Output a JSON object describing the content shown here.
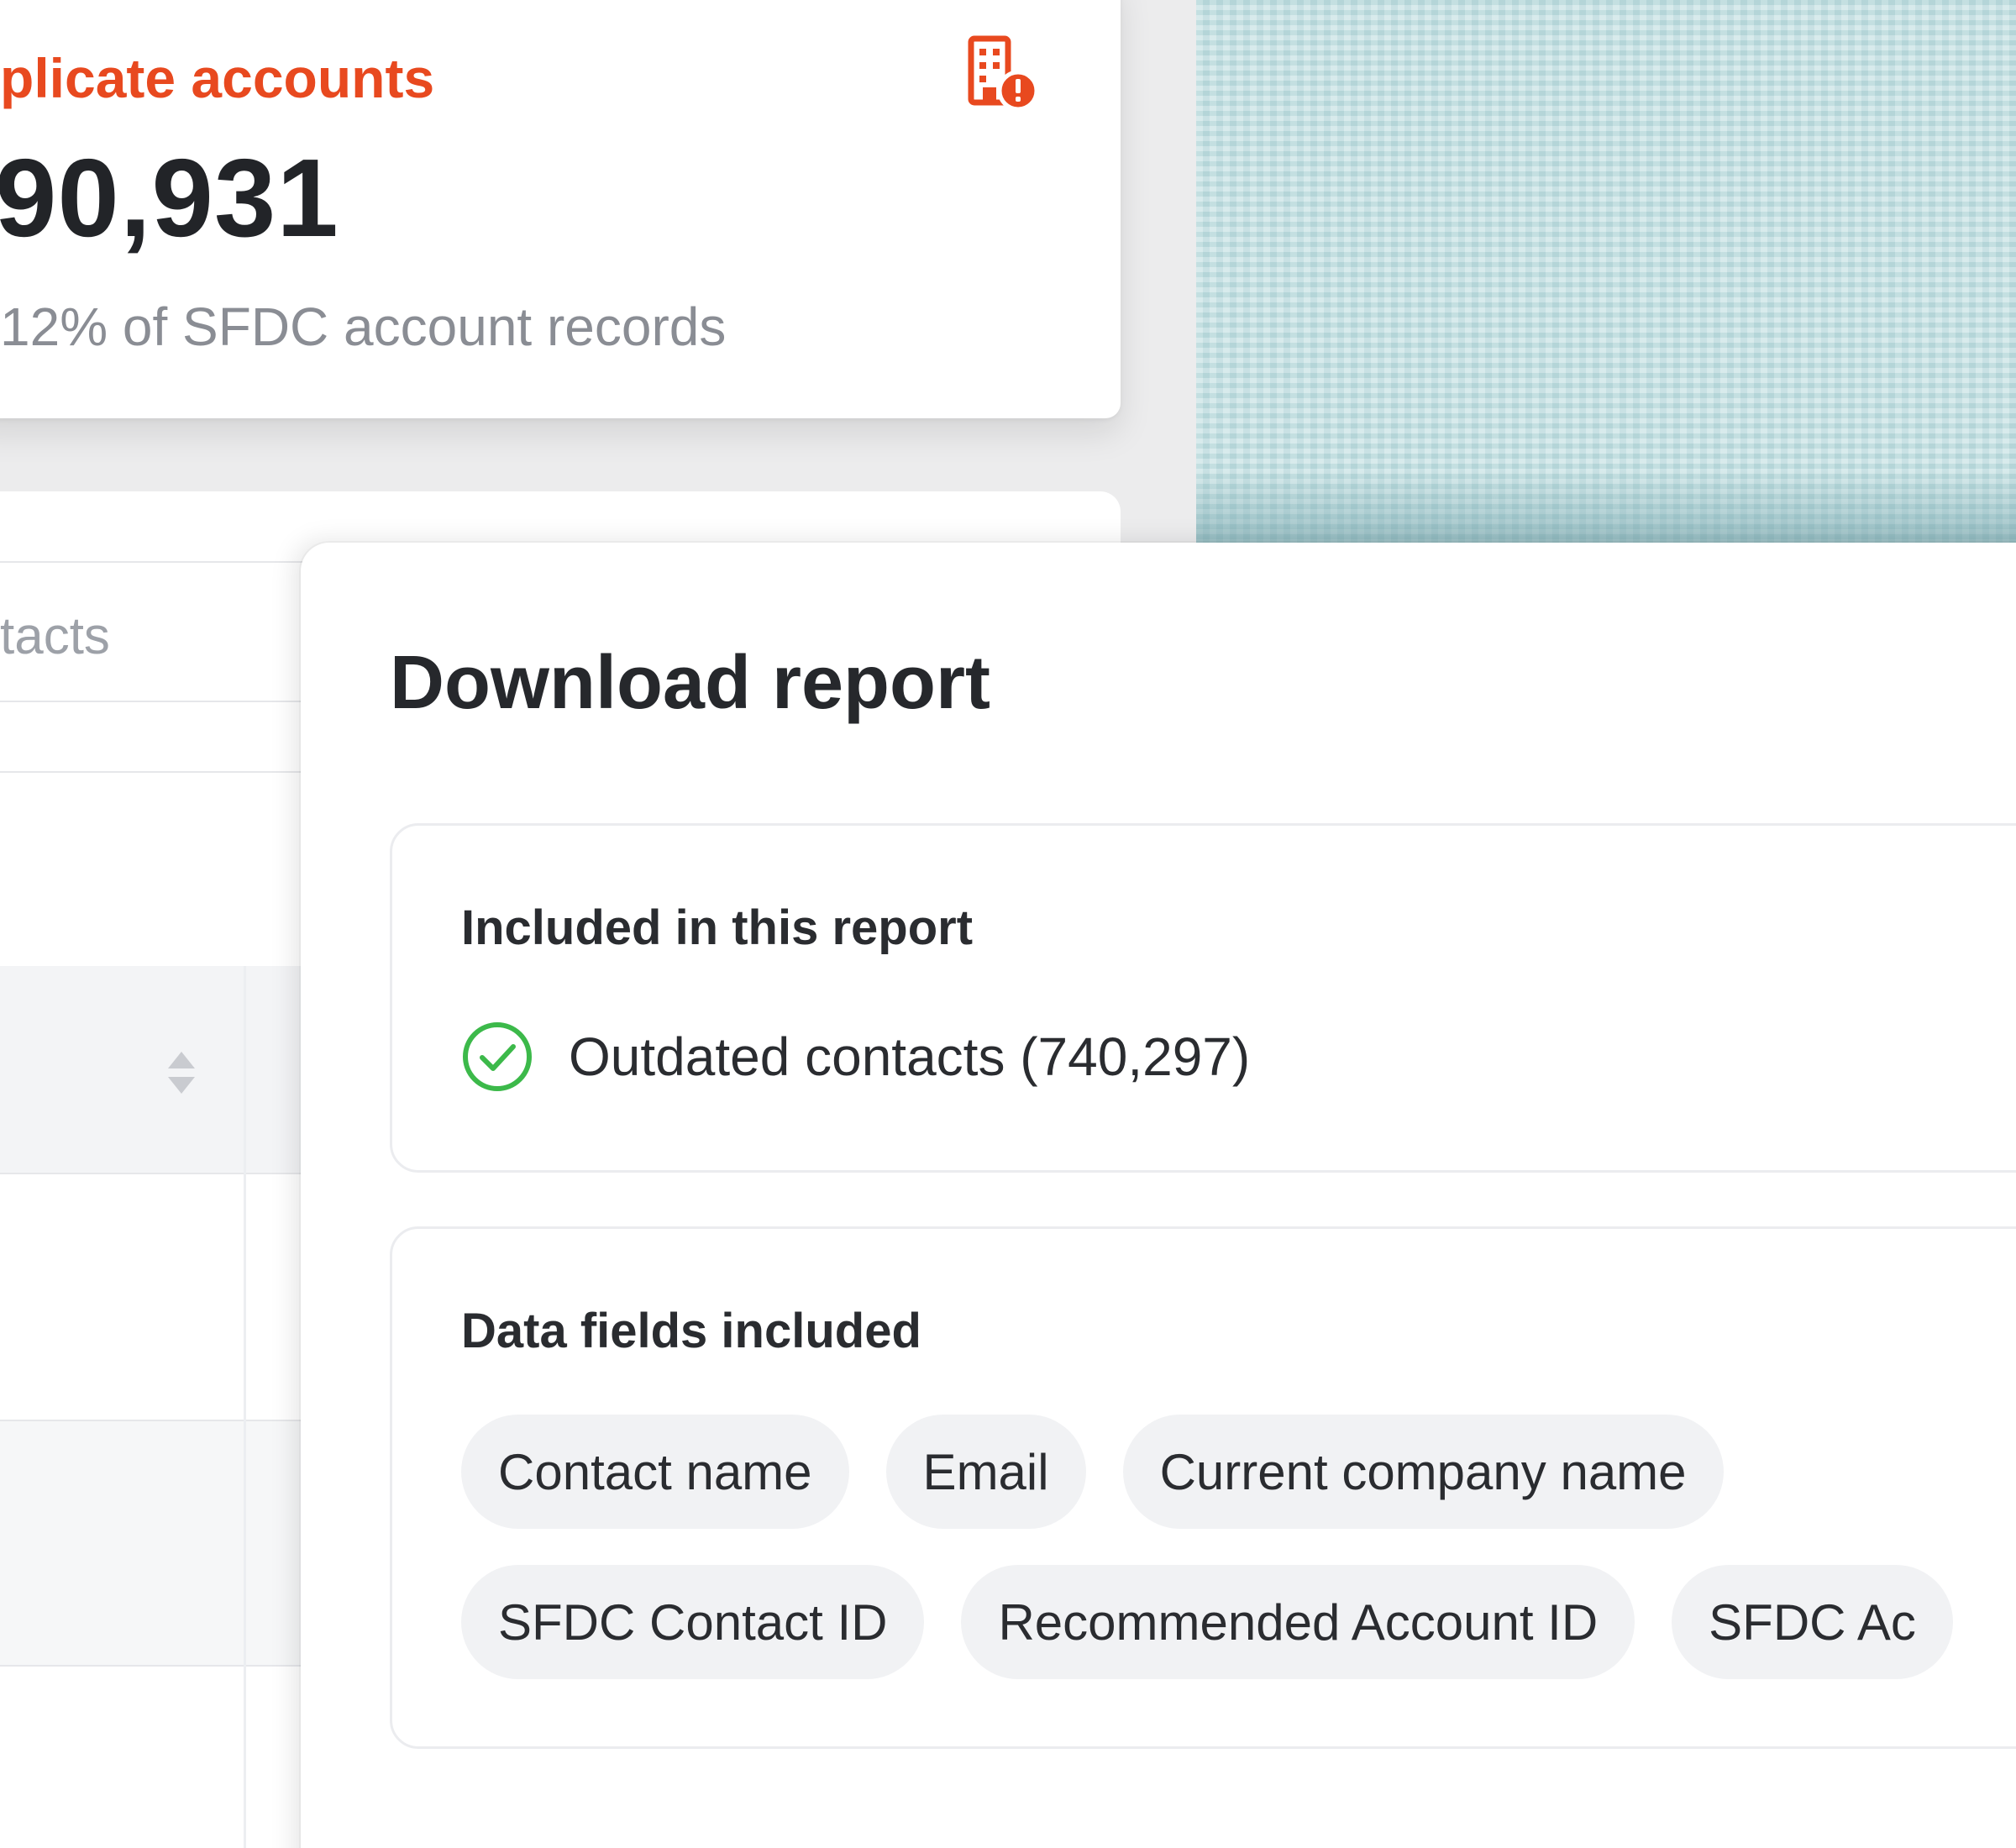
{
  "stat_card": {
    "title": "plicate accounts",
    "value": "90,931",
    "subtitle": "12% of SFDC account records",
    "icon": "building-alert-icon",
    "accent_color": "#e8491f"
  },
  "table": {
    "search_placeholder": "tacts",
    "sort_icon": "sort-icon"
  },
  "modal": {
    "title": "Download report",
    "included_section": {
      "heading": "Included in this report",
      "items": [
        {
          "label": "Outdated contacts (740,297)",
          "icon": "check-circle-icon",
          "color": "#3cb94a"
        }
      ]
    },
    "fields_section": {
      "heading": "Data fields included",
      "chips_row1": [
        "Contact name",
        "Email",
        "Current company name"
      ],
      "chips_row2": [
        "SFDC Contact ID",
        "Recommended Account ID",
        "SFDC Ac"
      ]
    }
  }
}
